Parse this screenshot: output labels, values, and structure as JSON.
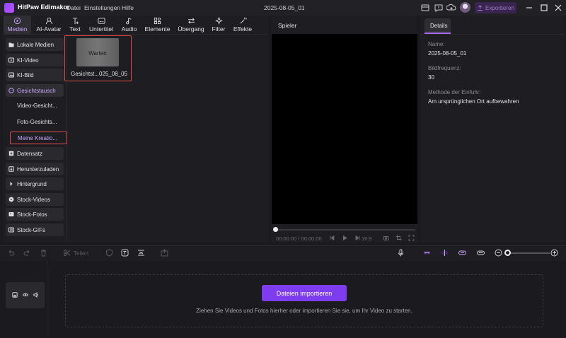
{
  "app": {
    "title": "HitPaw Edimakor",
    "menu": [
      "Datei",
      "Einstellungen",
      "Hilfe"
    ],
    "project_title": "2025-08-05_01",
    "export_label": "Exportieren"
  },
  "toolbar": {
    "tools": [
      {
        "label": "Medien",
        "icon": "media-icon"
      },
      {
        "label": "AI-Avatar",
        "icon": "ai-avatar-icon"
      },
      {
        "label": "Text",
        "icon": "text-icon"
      },
      {
        "label": "Untertitel",
        "icon": "subtitle-icon"
      },
      {
        "label": "Audio",
        "icon": "audio-icon"
      },
      {
        "label": "Elemente",
        "icon": "elements-icon"
      },
      {
        "label": "Übergang",
        "icon": "transition-icon"
      },
      {
        "label": "Filter",
        "icon": "filter-icon"
      },
      {
        "label": "Effekte",
        "icon": "effects-icon"
      }
    ]
  },
  "sidebar": {
    "items": [
      {
        "label": "Lokale Medien"
      },
      {
        "label": "KI-Video"
      },
      {
        "label": "KI-Bild"
      },
      {
        "label": "Gesichtstausch"
      },
      {
        "label": "Video-Gesicht..."
      },
      {
        "label": "Foto-Gesichts..."
      },
      {
        "label": "Meine Kreatio..."
      },
      {
        "label": "Datensatz"
      },
      {
        "label": "Herunterzuladen"
      },
      {
        "label": "Hintergrund"
      },
      {
        "label": "Stock-Videos"
      },
      {
        "label": "Stock-Fotos"
      },
      {
        "label": "Stock-GIFs"
      }
    ]
  },
  "media": {
    "thumb_status": "Warten",
    "thumb_name": "Gesichtst...025_08_05"
  },
  "player": {
    "title": "Spieler",
    "time": "00:00:00 / 00:00:00",
    "ratio": "16:9"
  },
  "details": {
    "tab": "Details",
    "name_label": "Name:",
    "name_value": "2025-08-05_01",
    "fps_label": "Bildfrequenz:",
    "fps_value": "30",
    "method_label": "Methode der Einfuhr:",
    "method_value": "Am ursprünglichen Ort aufbewahren"
  },
  "timeline": {
    "split_label": "Teilen",
    "import_button": "Dateien importieren",
    "drop_hint": "Ziehen Sie Videos und Fotos hierher oder importieren Sie sie, um Ihr Video zu starten."
  },
  "colors": {
    "accent": "#7d3cf0",
    "accent_text": "#c9a6ff",
    "highlight_border": "#e04848"
  }
}
